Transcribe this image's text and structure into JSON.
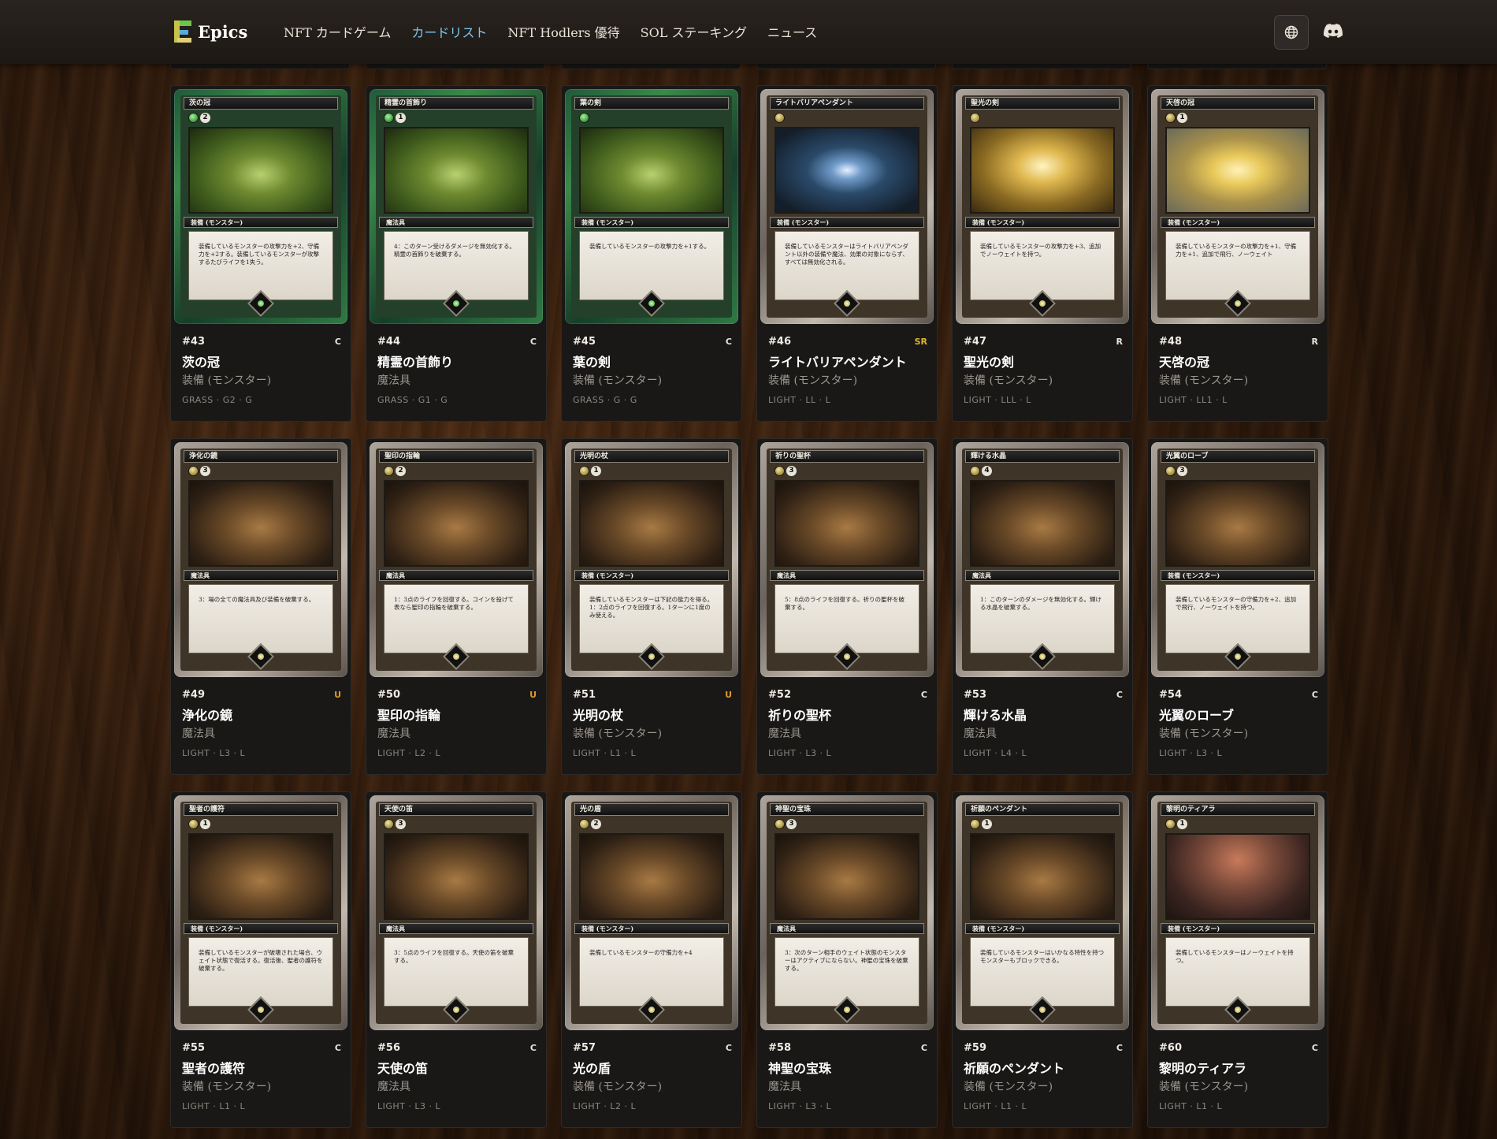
{
  "header": {
    "logo_text": "Epics",
    "nav": [
      {
        "label": "NFT カードゲーム",
        "active": false
      },
      {
        "label": "カードリスト",
        "active": true
      },
      {
        "label": "NFT Hodlers 優待",
        "active": false
      },
      {
        "label": "SOL ステーキング",
        "active": false
      },
      {
        "label": "ニュース",
        "active": false
      }
    ],
    "globe_icon": "globe-icon",
    "discord_icon": "discord-icon",
    "active_color": "#7cc4f0"
  },
  "cards": [
    {
      "number": "#43",
      "rarity": "C",
      "name": "茨の冠",
      "type": "装備 (モンスター)",
      "code": "GRASS · G2 · G",
      "art_title": "茨の冠",
      "cost": "2",
      "art_type": "装備 (モンスター)",
      "text": "装備しているモンスターの攻撃力を+2、守備力を+2する。装備しているモンスターが攻撃するたびライフを1失う。",
      "frame": "grass",
      "pic": "green"
    },
    {
      "number": "#44",
      "rarity": "C",
      "name": "精霊の首飾り",
      "type": "魔法具",
      "code": "GRASS · G1 · G",
      "art_title": "精霊の首飾り",
      "cost": "1",
      "art_type": "魔法具",
      "text": "4：このターン受けるダメージを無効化する。精霊の首飾りを破棄する。",
      "frame": "grass",
      "pic": "green"
    },
    {
      "number": "#45",
      "rarity": "C",
      "name": "葉の剣",
      "type": "装備 (モンスター)",
      "code": "GRASS · G · G",
      "art_title": "葉の剣",
      "cost": "",
      "art_type": "装備 (モンスター)",
      "text": "装備しているモンスターの攻撃力を+1する。",
      "frame": "grass",
      "pic": "green"
    },
    {
      "number": "#46",
      "rarity": "SR",
      "name": "ライトバリアペンダント",
      "type": "装備 (モンスター)",
      "code": "LIGHT · LL · L",
      "art_title": "ライトバリアペンダント",
      "cost": "",
      "art_type": "装備 (モンスター)",
      "text": "装備しているモンスターはライトバリアペンダント以外の装備や魔法、効果の対象にならず、すべては無効化される。",
      "frame": "light",
      "pic": "blue"
    },
    {
      "number": "#47",
      "rarity": "R",
      "name": "聖光の剣",
      "type": "装備 (モンスター)",
      "code": "LIGHT · LLL · L",
      "art_title": "聖光の剣",
      "cost": "",
      "art_type": "装備 (モンスター)",
      "text": "装備しているモンスターの攻撃力を+3、追加でノーウェイトを持つ。",
      "frame": "light",
      "pic": "gold"
    },
    {
      "number": "#48",
      "rarity": "R",
      "name": "天啓の冠",
      "type": "装備 (モンスター)",
      "code": "LIGHT · LL1 · L",
      "art_title": "天啓の冠",
      "cost": "1",
      "art_type": "装備 (モンスター)",
      "text": "装備しているモンスターの攻撃力を+1、守備力を+1、追加で飛行、ノーウェイト",
      "frame": "light",
      "pic": "gold2"
    },
    {
      "number": "#49",
      "rarity": "U",
      "name": "浄化の鏡",
      "type": "魔法具",
      "code": "LIGHT · L3 · L",
      "art_title": "浄化の鏡",
      "cost": "3",
      "art_type": "魔法具",
      "text": "3：場の全ての魔法具及び装備を破棄する。",
      "frame": "light",
      "pic": "brown"
    },
    {
      "number": "#50",
      "rarity": "U",
      "name": "聖印の指輪",
      "type": "魔法具",
      "code": "LIGHT · L2 · L",
      "art_title": "聖印の指輪",
      "cost": "2",
      "art_type": "魔法具",
      "text": "1：3点のライフを回復する。コインを投げて表なら聖印の指輪を破棄する。",
      "frame": "light",
      "pic": "brown"
    },
    {
      "number": "#51",
      "rarity": "U",
      "name": "光明の杖",
      "type": "装備 (モンスター)",
      "code": "LIGHT · L1 · L",
      "art_title": "光明の杖",
      "cost": "1",
      "art_type": "装備 (モンスター)",
      "text": "装備しているモンスターは下記の能力を得る。1：2点のライフを回復する。1ターンに1度のみ使える。",
      "frame": "light",
      "pic": "brown"
    },
    {
      "number": "#52",
      "rarity": "C",
      "name": "祈りの聖杯",
      "type": "魔法具",
      "code": "LIGHT · L3 · L",
      "art_title": "祈りの聖杯",
      "cost": "3",
      "art_type": "魔法具",
      "text": "5：8点のライフを回復する。祈りの聖杯を破棄する。",
      "frame": "light",
      "pic": "brown"
    },
    {
      "number": "#53",
      "rarity": "C",
      "name": "輝ける水晶",
      "type": "魔法具",
      "code": "LIGHT · L4 · L",
      "art_title": "輝ける水晶",
      "cost": "4",
      "art_type": "魔法具",
      "text": "1：このターンのダメージを無効化する。輝ける水晶を破棄する。",
      "frame": "light",
      "pic": "brown"
    },
    {
      "number": "#54",
      "rarity": "C",
      "name": "光翼のローブ",
      "type": "装備 (モンスター)",
      "code": "LIGHT · L3 · L",
      "art_title": "光翼のローブ",
      "cost": "3",
      "art_type": "装備 (モンスター)",
      "text": "装備しているモンスターの守備力を+2、追加で飛行、ノーウェイトを持つ。",
      "frame": "light",
      "pic": "brown"
    },
    {
      "number": "#55",
      "rarity": "C",
      "name": "聖者の護符",
      "type": "装備 (モンスター)",
      "code": "LIGHT · L1 · L",
      "art_title": "聖者の護符",
      "cost": "1",
      "art_type": "装備 (モンスター)",
      "text": "装備しているモンスターが破壊された場合、ウェイト状態で復活する。復活後、聖者の護符を破棄する。",
      "frame": "light",
      "pic": "brown"
    },
    {
      "number": "#56",
      "rarity": "C",
      "name": "天使の笛",
      "type": "魔法具",
      "code": "LIGHT · L3 · L",
      "art_title": "天使の笛",
      "cost": "3",
      "art_type": "魔法具",
      "text": "3：5点のライフを回復する。天使の笛を破棄する。",
      "frame": "light",
      "pic": "brown"
    },
    {
      "number": "#57",
      "rarity": "C",
      "name": "光の盾",
      "type": "装備 (モンスター)",
      "code": "LIGHT · L2 · L",
      "art_title": "光の盾",
      "cost": "2",
      "art_type": "装備 (モンスター)",
      "text": "装備しているモンスターの守備力を+4",
      "frame": "light",
      "pic": "brown"
    },
    {
      "number": "#58",
      "rarity": "C",
      "name": "神聖の宝珠",
      "type": "魔法具",
      "code": "LIGHT · L3 · L",
      "art_title": "神聖の宝珠",
      "cost": "3",
      "art_type": "魔法具",
      "text": "3：次のターン相手のウェイト状態のモンスターはアクティブにならない。神聖の宝珠を破棄する。",
      "frame": "light",
      "pic": "brown"
    },
    {
      "number": "#59",
      "rarity": "C",
      "name": "祈願のペンダント",
      "type": "装備 (モンスター)",
      "code": "LIGHT · L1 · L",
      "art_title": "祈願のペンダント",
      "cost": "1",
      "art_type": "装備 (モンスター)",
      "text": "装備しているモンスターはいかなる特性を持つモンスターもブロックできる。",
      "frame": "light",
      "pic": "brown"
    },
    {
      "number": "#60",
      "rarity": "C",
      "name": "黎明のティアラ",
      "type": "装備 (モンスター)",
      "code": "LIGHT · L1 · L",
      "art_title": "黎明のティアラ",
      "cost": "1",
      "art_type": "装備 (モンスター)",
      "text": "装備しているモンスターはノーウェイトを持つ。",
      "frame": "light",
      "pic": "dusk"
    }
  ]
}
